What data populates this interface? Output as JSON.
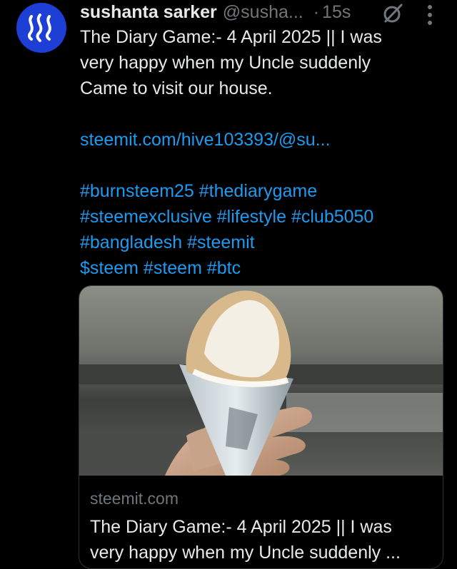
{
  "post": {
    "author_name": "sushanta sarker",
    "handle": "@susha...",
    "separator": "·",
    "time": "15s",
    "text_lines": [
      "The Diary Game:-  4 April 2025  || I was",
      "very happy when my Uncle suddenly",
      "Came to visit our house."
    ],
    "link": "steemit.com/hive103393/@su...",
    "hashtag_lines": [
      "#burnsteem25 #thediarygame",
      "#steemexclusive #lifestyle #club5050",
      "#bangladesh #steemit",
      "$steem #steem #btc"
    ]
  },
  "card": {
    "domain": "steemit.com",
    "title_lines": [
      "The Diary Game:- 4 April 2025 || I was",
      "very happy when my Uncle suddenly ..."
    ]
  },
  "icons": {
    "avatar": "steem-logo-icon",
    "grok": "grok-icon",
    "more": "more-vertical-icon"
  },
  "colors": {
    "background": "#000000",
    "text": "#e7e9ea",
    "muted": "#71767b",
    "link": "#1d9bf0",
    "avatar_bg": "#1d3fd6"
  }
}
